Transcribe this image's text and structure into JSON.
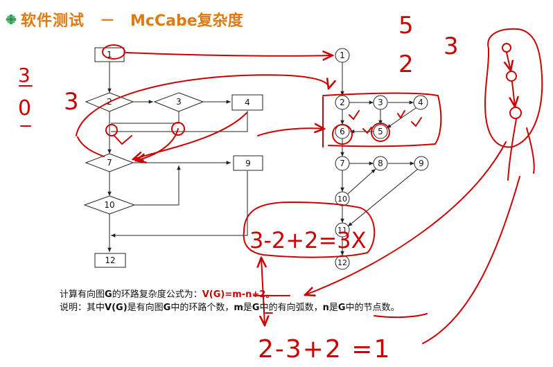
{
  "title": {
    "part1": "软件测试",
    "dash": "－",
    "part2": "McCabe复杂度"
  },
  "flowchart": {
    "nodes": {
      "n1": "1",
      "n2": "2",
      "n3": "3",
      "n4": "4",
      "n7": "7",
      "n9": "9",
      "n10": "10",
      "n12": "12"
    }
  },
  "flowgraph": {
    "nodes": {
      "g1": "1",
      "g2": "2",
      "g3": "3",
      "g4": "4",
      "g5": "5",
      "g6": "6",
      "g7": "7",
      "g8": "8",
      "g9": "9",
      "g10": "10",
      "g11": "11",
      "g12": "12"
    }
  },
  "caption": {
    "line1_prefix": "计算有向图",
    "line1_G": "G",
    "line1_mid": "的环路复杂度公式为：",
    "line1_formula": "V(G)=m-n+2",
    "line1_end": "。",
    "line2_prefix": "说明：其中",
    "line2_VG": "V(G)",
    "line2_a": "是有向图",
    "line2_G1": "G",
    "line2_b": "中的环路个数，",
    "line2_m": "m",
    "line2_c": "是",
    "line2_G2": "G",
    "line2_d": "中的有向弧数，",
    "line2_n": "n",
    "line2_e": "是",
    "line2_G3": "G",
    "line2_f": "中的节点数。"
  },
  "annotations": {
    "top_5": "5",
    "top_3": "3",
    "top_2": "2",
    "left_frac_top": "3",
    "left_frac_bottom": "0",
    "left_3": "3",
    "calc1": "3-2+2=3X",
    "calc2": "2-3+2 =1"
  },
  "colors": {
    "title": "#e07a10",
    "ink": "#cc0000",
    "line": "#222222"
  }
}
